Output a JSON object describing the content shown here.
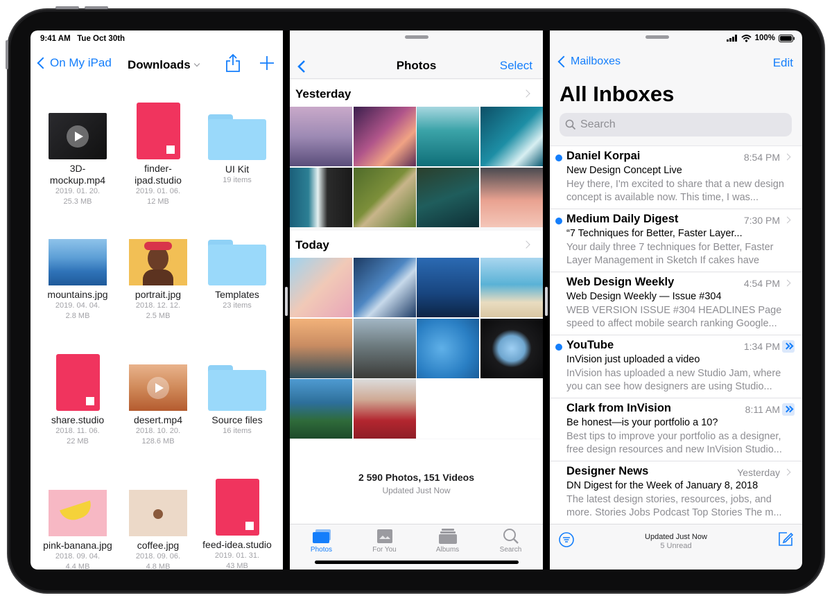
{
  "files": {
    "status_time": "9:41 AM",
    "status_date": "Tue Oct 30th",
    "back_label": "On My iPad",
    "title": "Downloads",
    "items": [
      {
        "name": "3D-\nmockup.mp4",
        "meta1": "2019. 01. 20.",
        "meta2": "25.3 MB"
      },
      {
        "name": "finder-\nipad.studio",
        "meta1": "2019. 01. 06.",
        "meta2": "12 MB"
      },
      {
        "name": "UI Kit",
        "meta1": "19 items",
        "meta2": ""
      },
      {
        "name": "mountains.jpg",
        "meta1": "2019. 04. 04.",
        "meta2": "2.8 MB"
      },
      {
        "name": "portrait.jpg",
        "meta1": "2018. 12. 12.",
        "meta2": "2.5 MB"
      },
      {
        "name": "Templates",
        "meta1": "23 items",
        "meta2": ""
      },
      {
        "name": "share.studio",
        "meta1": "2018. 11. 06.",
        "meta2": "22 MB"
      },
      {
        "name": "desert.mp4",
        "meta1": "2018. 10. 20.",
        "meta2": "128.6 MB"
      },
      {
        "name": "Source files",
        "meta1": "16 items",
        "meta2": ""
      },
      {
        "name": "pink-banana.jpg",
        "meta1": "2018. 09. 04.",
        "meta2": "4.4 MB"
      },
      {
        "name": "coffee.jpg",
        "meta1": "2018. 09. 06.",
        "meta2": "4.8 MB"
      },
      {
        "name": "feed-idea.studio",
        "meta1": "2019. 01. 31.",
        "meta2": "43 MB"
      }
    ]
  },
  "photos": {
    "title": "Photos",
    "select_label": "Select",
    "section_yesterday": "Yesterday",
    "section_today": "Today",
    "count": "2 590 Photos, 151 Videos",
    "updated": "Updated Just Now",
    "tabs": [
      {
        "label": "Photos"
      },
      {
        "label": "For You"
      },
      {
        "label": "Albums"
      },
      {
        "label": "Search"
      }
    ],
    "accent": "#147efb"
  },
  "mail": {
    "status_battery": "100%",
    "back_label": "Mailboxes",
    "edit_label": "Edit",
    "title": "All Inboxes",
    "search_placeholder": "Search",
    "updated": "Updated Just Now",
    "unread": "5 Unread",
    "messages": [
      {
        "sender": "Daniel Korpai",
        "time": "8:54 PM",
        "subject": "New Design Concept Live",
        "preview": "Hey there, I'm excited to share that a new design concept is available now. This time, I was..."
      },
      {
        "sender": "Medium Daily Digest",
        "time": "7:30 PM",
        "subject": "“7 Techniques for Better, Faster Layer...",
        "preview": "Your daily three 7 techniques for Better, Faster Layer Management in Sketch If cakes have laye..."
      },
      {
        "sender": "Web Design Weekly",
        "time": "4:54 PM",
        "subject": "Web Design Weekly — Issue #304",
        "preview": "WEB VERSION ISSUE #304 HEADLINES Page speed to affect mobile search ranking Google..."
      },
      {
        "sender": "YouTube",
        "time": "1:34 PM",
        "subject": "InVision just uploaded a video",
        "preview": "InVision has uploaded a new Studio Jam, where you can see how designers are using Studio..."
      },
      {
        "sender": "Clark from InVision",
        "time": "8:11 AM",
        "subject": "Be honest—is your portfolio a 10?",
        "preview": "Best tips to improve your portfolio as a designer, free design resources and new InVision Studio..."
      },
      {
        "sender": "Designer News",
        "time": "Yesterday",
        "subject": "DN Digest for the Week of January 8, 2018",
        "preview": "The latest design stories, resources, jobs, and more. Stories Jobs Podcast Top Stories The m..."
      }
    ]
  }
}
